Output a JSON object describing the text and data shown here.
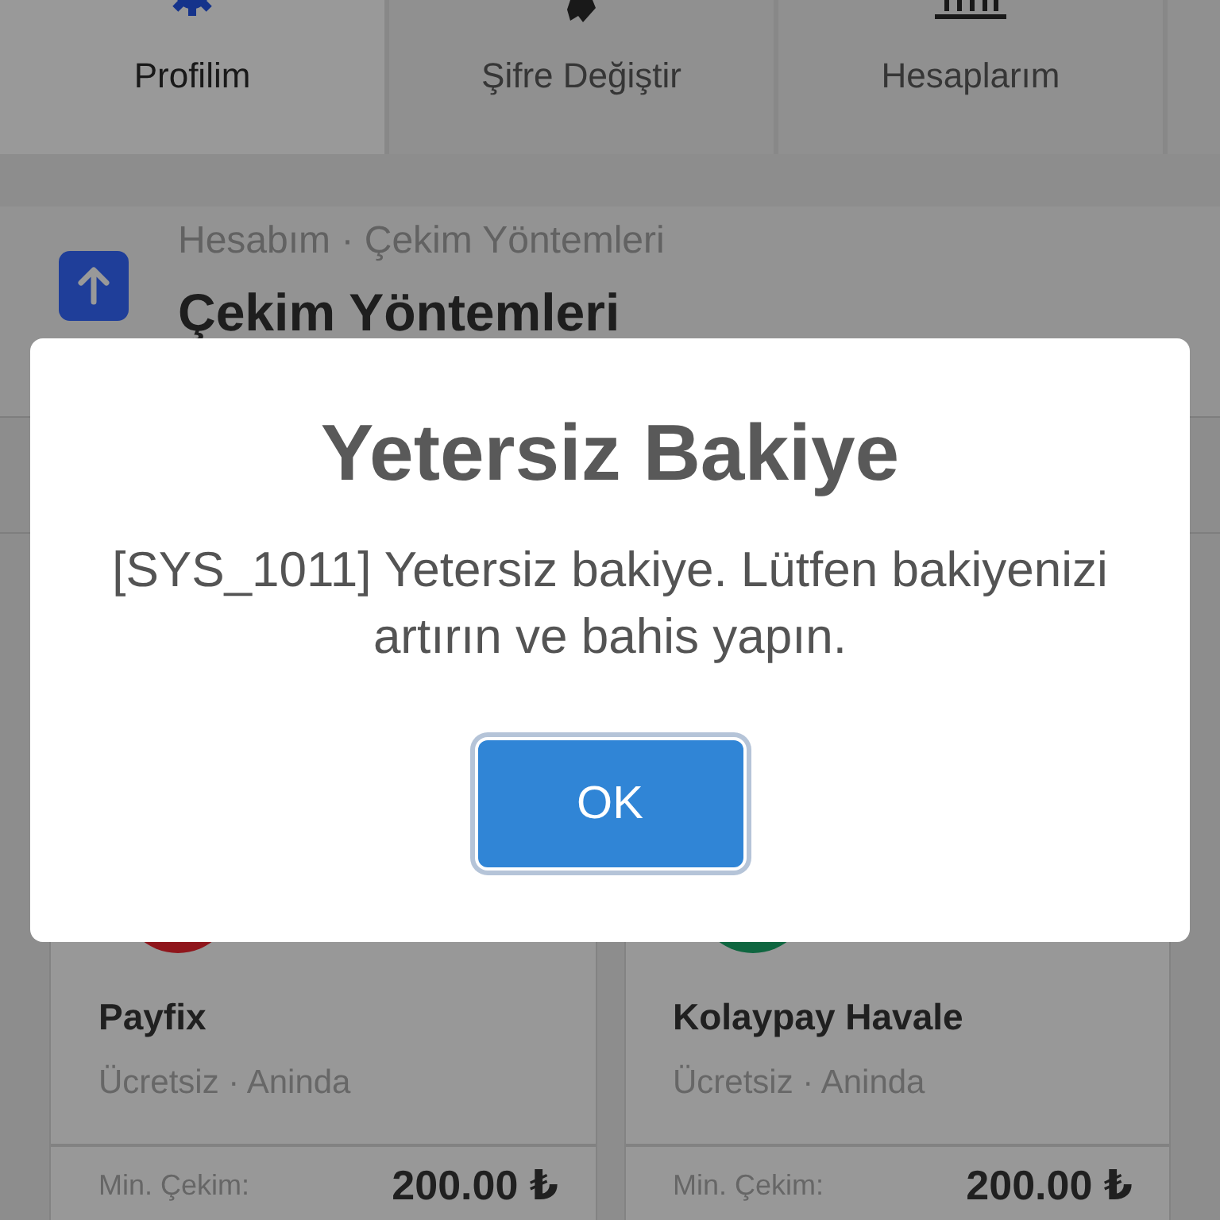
{
  "tabs": [
    {
      "label": "Profilim",
      "selected": true
    },
    {
      "label": "Şifre Değiştir",
      "selected": false
    },
    {
      "label": "Hesaplarım",
      "selected": false
    }
  ],
  "header": {
    "breadcrumb": "Hesabım · Çekim Yöntemleri",
    "title": "Çekim Yöntemleri"
  },
  "methods": [
    {
      "name": "Payfix",
      "details": "Ücretsiz · Aninda",
      "min_label": "Min. Çekim:",
      "min_amount": "200.00 ₺"
    },
    {
      "name": "Kolaypay Havale",
      "details": "Ücretsiz · Aninda",
      "min_label": "Min. Çekim:",
      "min_amount": "200.00 ₺"
    }
  ],
  "dialog": {
    "title": "Yetersiz Bakiye",
    "message": "[SYS_1011] Yetersiz bakiye. Lütfen bakiyenizi artırın ve bahis yapın.",
    "button": "OK"
  }
}
